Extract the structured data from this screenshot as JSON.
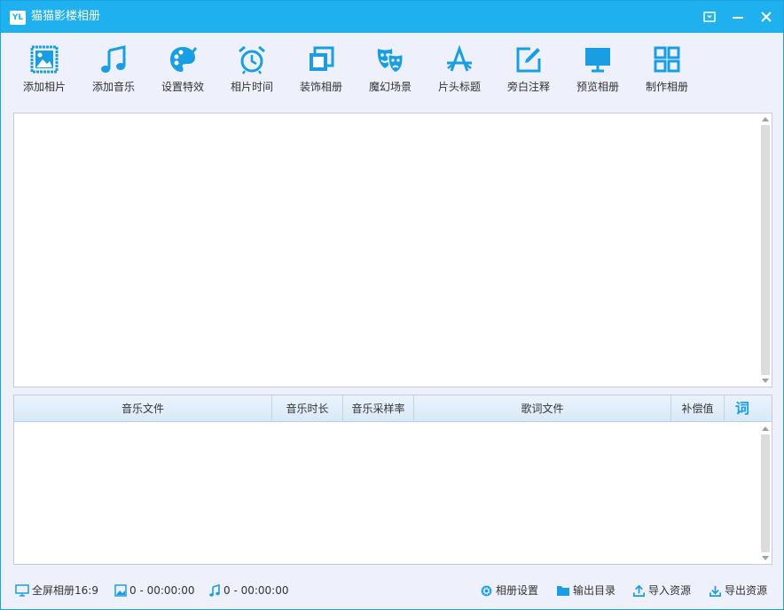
{
  "window": {
    "logo": "YL",
    "title": "猫猫影楼相册"
  },
  "toolbar": {
    "items": [
      {
        "label": "添加相片",
        "icon": "picture-icon"
      },
      {
        "label": "添加音乐",
        "icon": "music-note-icon"
      },
      {
        "label": "设置特效",
        "icon": "palette-icon"
      },
      {
        "label": "相片时间",
        "icon": "alarm-clock-icon"
      },
      {
        "label": "装饰相册",
        "icon": "stacked-frames-icon"
      },
      {
        "label": "魔幻场景",
        "icon": "theater-mask-icon"
      },
      {
        "label": "片头标题",
        "icon": "title-a-icon"
      },
      {
        "label": "旁白注释",
        "icon": "edit-note-icon"
      },
      {
        "label": "预览相册",
        "icon": "monitor-icon"
      },
      {
        "label": "制作相册",
        "icon": "grid-icon"
      }
    ]
  },
  "music_table": {
    "columns": [
      "音乐文件",
      "音乐时长",
      "音乐采样率",
      "歌词文件",
      "补偿值"
    ],
    "lyric_button": "词",
    "rows": []
  },
  "status": {
    "mode": "全屏相册16:9",
    "photo_summary": "0 - 00:00:00",
    "music_summary": "0 - 00:00:00",
    "album_settings": "相册设置",
    "output_dir": "输出目录",
    "import_resources": "导入资源",
    "export_resources": "导出资源"
  },
  "colors": {
    "accent": "#1fb0f0",
    "icon": "#1a9ee3",
    "toolbar_bg": "#eef0fb"
  }
}
